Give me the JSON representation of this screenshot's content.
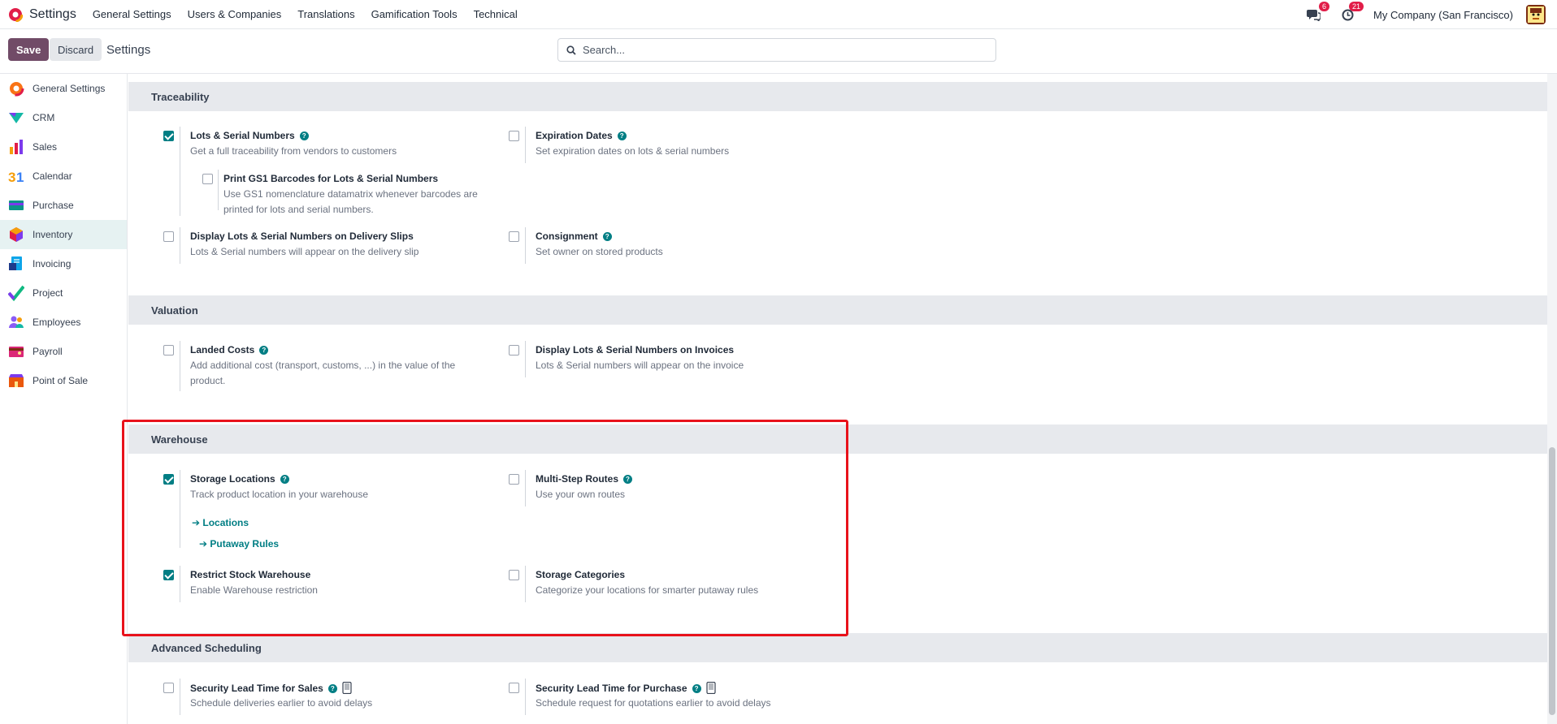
{
  "topbar": {
    "app_name": "Settings",
    "menu": [
      "General Settings",
      "Users & Companies",
      "Translations",
      "Gamification Tools",
      "Technical"
    ],
    "messages_badge": "6",
    "activities_badge": "21",
    "company": "My Company (San Francisco)"
  },
  "control": {
    "save_label": "Save",
    "discard_label": "Discard",
    "title": "Settings",
    "search_placeholder": "Search..."
  },
  "sidebar": {
    "items": [
      {
        "label": "General Settings",
        "icon": "settings-app-icon",
        "color": "#f97316"
      },
      {
        "label": "CRM",
        "icon": "crm-app-icon",
        "color": "#14b8a6"
      },
      {
        "label": "Sales",
        "icon": "sales-app-icon",
        "color": "#f59e0b"
      },
      {
        "label": "Calendar",
        "icon": "calendar-app-icon",
        "color": "#3b82f6"
      },
      {
        "label": "Purchase",
        "icon": "purchase-app-icon",
        "color": "#0d9488"
      },
      {
        "label": "Inventory",
        "icon": "inventory-app-icon",
        "color": "#e11d48"
      },
      {
        "label": "Invoicing",
        "icon": "invoicing-app-icon",
        "color": "#0ea5e9"
      },
      {
        "label": "Project",
        "icon": "project-app-icon",
        "color": "#10b981"
      },
      {
        "label": "Employees",
        "icon": "employees-app-icon",
        "color": "#8b5cf6"
      },
      {
        "label": "Payroll",
        "icon": "payroll-app-icon",
        "color": "#db2777"
      },
      {
        "label": "Point of Sale",
        "icon": "pos-app-icon",
        "color": "#ea580c"
      }
    ],
    "active": "Inventory"
  },
  "sections": {
    "traceability": {
      "title": "Traceability",
      "lots": {
        "title": "Lots & Serial Numbers",
        "desc": "Get a full traceability from vendors to customers",
        "checked": true
      },
      "gs1": {
        "title": "Print GS1 Barcodes for Lots & Serial Numbers",
        "desc": "Use GS1 nomenclature datamatrix whenever barcodes are printed for lots and serial numbers.",
        "checked": false
      },
      "expiration": {
        "title": "Expiration Dates",
        "desc": "Set expiration dates on lots & serial numbers",
        "checked": false
      },
      "display_slips": {
        "title": "Display Lots & Serial Numbers on Delivery Slips",
        "desc": "Lots & Serial numbers will appear on the delivery slip",
        "checked": false
      },
      "consignment": {
        "title": "Consignment",
        "desc": "Set owner on stored products",
        "checked": false
      }
    },
    "valuation": {
      "title": "Valuation",
      "landed": {
        "title": "Landed Costs",
        "desc": "Add additional cost (transport, customs, ...) in the value of the product.",
        "checked": false
      },
      "display_invoices": {
        "title": "Display Lots & Serial Numbers on Invoices",
        "desc": "Lots & Serial numbers will appear on the invoice",
        "checked": false
      }
    },
    "warehouse": {
      "title": "Warehouse",
      "storage": {
        "title": "Storage Locations",
        "desc": "Track product location in your warehouse",
        "checked": true
      },
      "locations_link": "Locations",
      "putaway_link": "Putaway Rules",
      "multistep": {
        "title": "Multi-Step Routes",
        "desc": "Use your own routes",
        "checked": false
      },
      "restrict": {
        "title": "Restrict Stock Warehouse",
        "desc": "Enable Warehouse restriction",
        "checked": true
      },
      "categories": {
        "title": "Storage Categories",
        "desc": "Categorize your locations for smarter putaway rules",
        "checked": false
      }
    },
    "advanced": {
      "title": "Advanced Scheduling",
      "lead_sales": {
        "title": "Security Lead Time for Sales",
        "desc": "Schedule deliveries earlier to avoid delays",
        "checked": false
      },
      "lead_purchase": {
        "title": "Security Lead Time for Purchase",
        "desc": "Schedule request for quotations earlier to avoid delays",
        "checked": false
      }
    }
  },
  "colors": {
    "primary": "#714b67",
    "accent": "#017e84",
    "highlight": "#e8121b"
  }
}
